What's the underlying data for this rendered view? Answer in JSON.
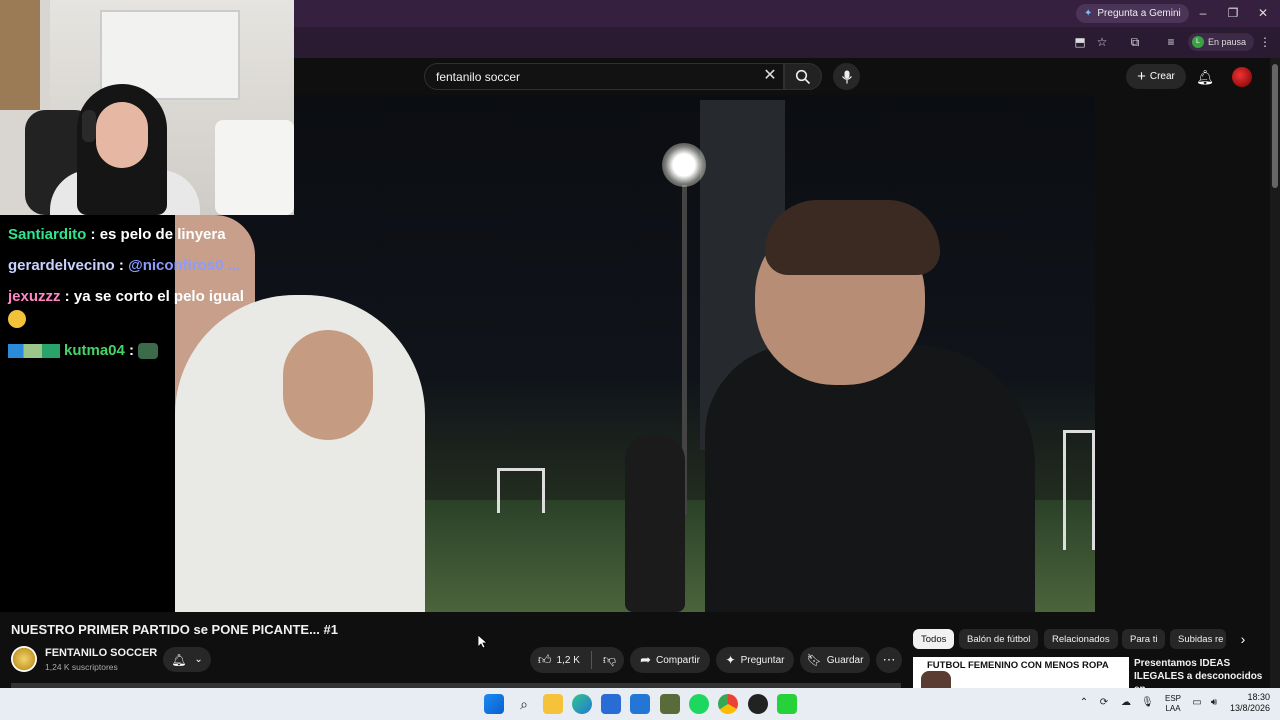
{
  "browser": {
    "gemini_button": "Pregunta a Gemini",
    "profile_initial": "L",
    "profile_status": "En pausa"
  },
  "youtube": {
    "search_value": "fentanilo soccer",
    "create_label": "Crear"
  },
  "chat": {
    "lines": [
      {
        "user": "Santiardito",
        "sep": " : ",
        "msg": "es pelo de linyera",
        "user_color": "#2ee58e"
      },
      {
        "user": "gerardelvecino",
        "sep": " : ",
        "msg": "@niconfiros0 ...",
        "user_color": "#c9d2ff"
      },
      {
        "user": "jexuzzz",
        "sep": " : ",
        "msg": "ya se corto el pelo igual",
        "user_color": "#ff86c6"
      },
      {
        "user": "kutma04",
        "sep": " : ",
        "msg": "",
        "user_color": "#45d46a"
      }
    ]
  },
  "video": {
    "title": "NUESTRO PRIMER PARTIDO se PONE PICANTE... #1",
    "channel_name": "FENTANILO SOCCER",
    "subscribers": "1,24 K suscriptores",
    "likes": "1,2 K",
    "share_label": "Compartir",
    "ask_label": "Preguntar",
    "save_label": "Guardar"
  },
  "chips": [
    "Todos",
    "Balón de fútbol",
    "Relacionados",
    "Para ti",
    "Subidas re"
  ],
  "recommendation": {
    "thumb_text": "FUTBOL FEMENINO CON MENOS ROPA",
    "title": "Presentamos IDEAS ILEGALES a desconocidos en"
  },
  "taskbar": {
    "lang_line1": "ESP",
    "lang_line2": "LAA",
    "time": "18:30",
    "date": "13/8/2026"
  },
  "colors": {
    "chrome_tab_bg": "#35203f",
    "youtube_bg": "#0f0f0f",
    "taskbar_bg": "#e8edf3"
  }
}
